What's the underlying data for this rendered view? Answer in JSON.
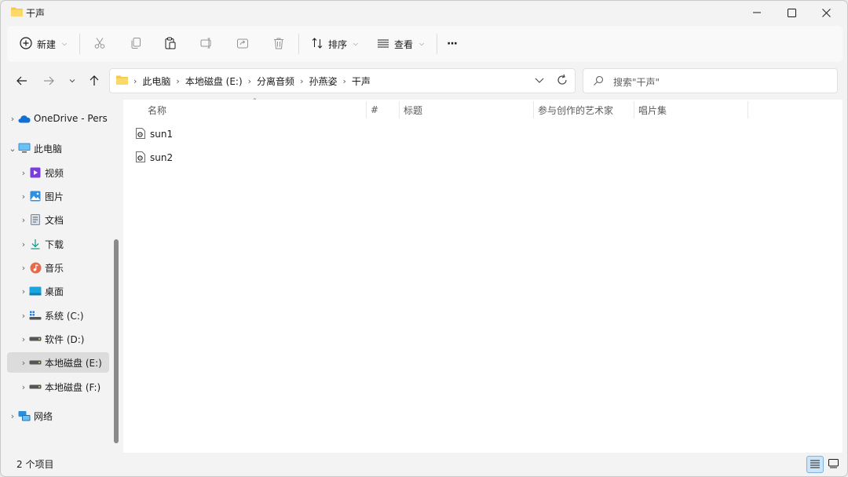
{
  "window": {
    "title": "干声"
  },
  "toolbar": {
    "new_label": "新建",
    "sort_label": "排序",
    "view_label": "查看",
    "more_label": "···"
  },
  "address": {
    "breadcrumbs": [
      "此电脑",
      "本地磁盘 (E:)",
      "分离音频",
      "孙燕姿",
      "干声"
    ],
    "search_placeholder": "搜索\"干声\""
  },
  "sidebar": {
    "items": [
      {
        "label": "OneDrive - Pers",
        "icon": "onedrive-icon"
      },
      {
        "label": "此电脑",
        "icon": "this-pc-icon"
      },
      {
        "label": "视频",
        "icon": "videos-icon"
      },
      {
        "label": "图片",
        "icon": "pictures-icon"
      },
      {
        "label": "文档",
        "icon": "documents-icon"
      },
      {
        "label": "下载",
        "icon": "downloads-icon"
      },
      {
        "label": "音乐",
        "icon": "music-icon"
      },
      {
        "label": "桌面",
        "icon": "desktop-icon"
      },
      {
        "label": "系统 (C:)",
        "icon": "system-drive-icon"
      },
      {
        "label": "软件 (D:)",
        "icon": "drive-icon"
      },
      {
        "label": "本地磁盘 (E:)",
        "icon": "drive-icon"
      },
      {
        "label": "本地磁盘 (F:)",
        "icon": "drive-icon"
      },
      {
        "label": "网络",
        "icon": "network-icon"
      }
    ]
  },
  "columns": {
    "name": "名称",
    "number": "#",
    "title": "标题",
    "artists": "参与创作的艺术家",
    "album": "唱片集"
  },
  "files": [
    {
      "name": "sun1",
      "icon": "audio-file-icon"
    },
    {
      "name": "sun2",
      "icon": "audio-file-icon"
    }
  ],
  "status": {
    "item_count": "2 个项目"
  },
  "colors": {
    "accent": "#0067c0",
    "folder": "#f7c948",
    "selection": "#dcdcdc"
  }
}
